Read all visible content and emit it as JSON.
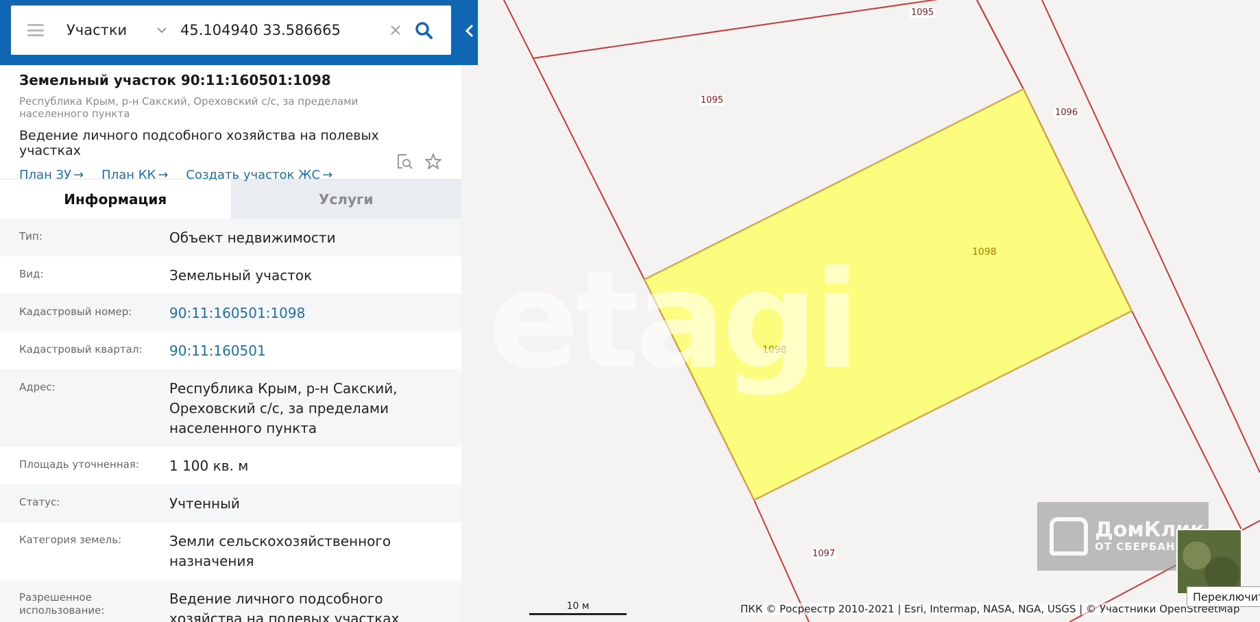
{
  "search": {
    "layer": "Участки",
    "query": "45.104940 33.586665"
  },
  "object": {
    "title": "Земельный участок 90:11:160501:1098",
    "address": "Республика Крым, р-н Сакский, Ореховский с/с, за пределами населенного пункта",
    "use": "Ведение личного подсобного хозяйства на полевых участках",
    "links": [
      "План ЗУ",
      "План КК",
      "Создать участок ЖС"
    ]
  },
  "tabs": [
    "Информация",
    "Услуги"
  ],
  "info_rows": [
    {
      "key": "Тип:",
      "value": "Объект недвижимости"
    },
    {
      "key": "Вид:",
      "value": "Земельный участок"
    },
    {
      "key": "Кадастровый номер:",
      "value": "90:11:160501:1098"
    },
    {
      "key": "Кадастровый квартал:",
      "value": "90:11:160501"
    },
    {
      "key": "Адрес:",
      "value": "Республика Крым, р-н Сакский, Ореховский с/с, за пределами населенного пункта"
    },
    {
      "key": "Площадь уточненная:",
      "value": "1 100 кв. м"
    },
    {
      "key": "Статус:",
      "value": "Учтенный"
    },
    {
      "key": "Категория земель:",
      "value": "Земли сельскохозяйственного назначения"
    },
    {
      "key": "Разрешенное использование:",
      "value": "Ведение личного подсобного хозяйства на полевых участках"
    }
  ],
  "map": {
    "parcel_labels": [
      "1095",
      "1095",
      "1096",
      "1098",
      "1098",
      "1097"
    ],
    "watermark": "etagi",
    "watermark2": {
      "line1": "ДомКлик",
      "line2": "ОТ СБЕРБАНКА"
    },
    "scale": "10 м",
    "attribution": "ПКК © Росреестр 2010-2021 | Esri, Intermap, NASA, NGA, USGS | © Участники OpenStreetMap",
    "switch_button": "Переключить",
    "colors": {
      "parcel_fill": "#fdfd79",
      "boundary": "#c73a3a",
      "panel_blue": "#1166b3",
      "link": "#1e6fa8"
    }
  }
}
